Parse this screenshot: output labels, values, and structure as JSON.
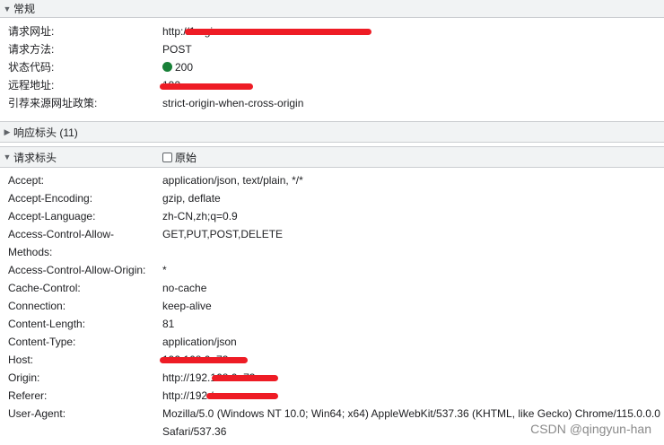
{
  "general": {
    "title": "常规",
    "rows": [
      {
        "key": "请求网址:",
        "value": "http://1                                ogin"
      },
      {
        "key": "请求方法:",
        "value": "POST"
      },
      {
        "key": "状态代码:",
        "value": "200"
      },
      {
        "key": "远程地址:",
        "value": "192.           "
      },
      {
        "key": "引荐来源网址政策:",
        "value": "strict-origin-when-cross-origin"
      }
    ],
    "status_color": "#188038"
  },
  "response_headers": {
    "title": "响应标头 (11)"
  },
  "request_headers": {
    "title": "请求标头",
    "raw_label": "原始",
    "rows": [
      {
        "key": "Accept:",
        "value": "application/json, text/plain, */*"
      },
      {
        "key": "Accept-Encoding:",
        "value": "gzip, deflate"
      },
      {
        "key": "Accept-Language:",
        "value": "zh-CN,zh;q=0.9"
      },
      {
        "key": "Access-Control-Allow-",
        "value": "GET,PUT,POST,DELETE"
      },
      {
        "key": "Methods:",
        "value": ""
      },
      {
        "key": "Access-Control-Allow-Origin:",
        "value": "*"
      },
      {
        "key": "Cache-Control:",
        "value": "no-cache"
      },
      {
        "key": "Connection:",
        "value": "keep-alive"
      },
      {
        "key": "Content-Length:",
        "value": "81"
      },
      {
        "key": "Content-Type:",
        "value": "application/json"
      },
      {
        "key": "Host:",
        "value": "192.168.0.           73"
      },
      {
        "key": "Origin:",
        "value": "http://192.168.0.          73"
      },
      {
        "key": "Referer:",
        "value": "http://192                /"
      },
      {
        "key": "User-Agent:",
        "value": "Mozilla/5.0 (Windows NT 10.0; Win64; x64) AppleWebKit/537.36 (KHTML, like Gecko) Chrome/115.0.0.0"
      },
      {
        "key": "",
        "value": "Safari/537.36"
      }
    ]
  },
  "watermark": "CSDN @qingyun-han",
  "redaction_color": "#ee1c25"
}
